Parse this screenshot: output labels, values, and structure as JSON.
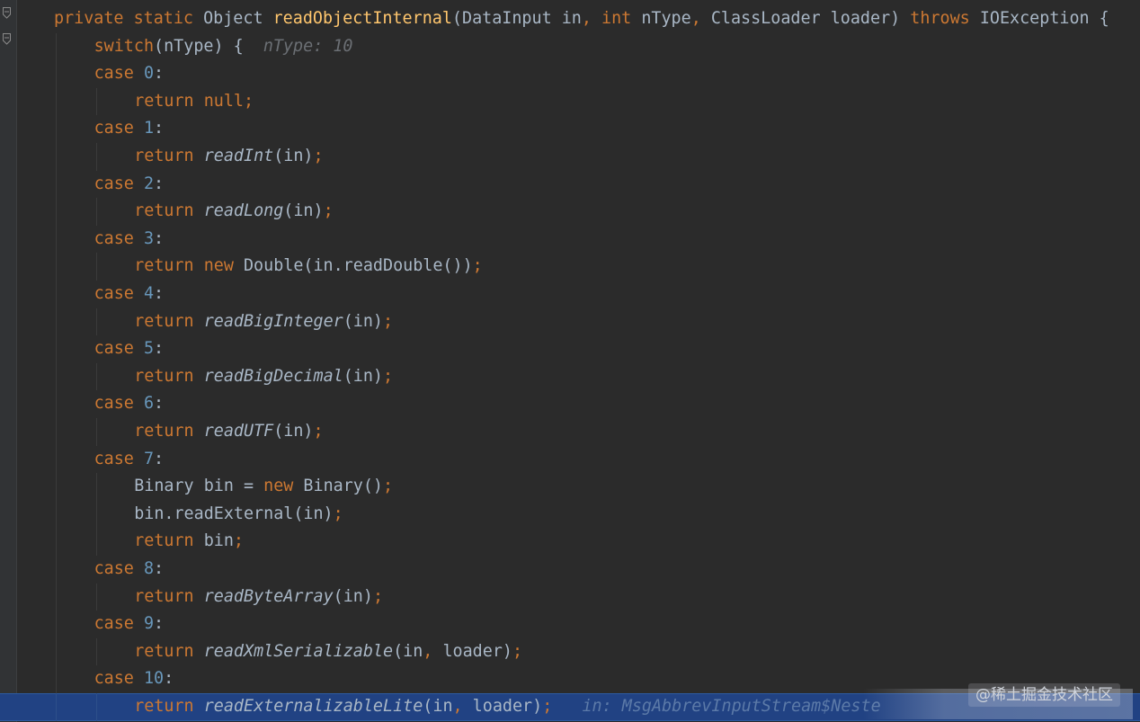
{
  "editor": {
    "hint_ntype": "nType: 10",
    "debug_inline": "in: MsgAbbrevInputStream$Neste",
    "watermark": "@稀土掘金技术社区",
    "lines": [
      {
        "indent": 0,
        "tokens": [
          {
            "t": "private static ",
            "c": "kw"
          },
          {
            "t": "Object ",
            "c": "plain"
          },
          {
            "t": "readObjectInternal",
            "c": "fn"
          },
          {
            "t": "(DataInput in",
            "c": "plain"
          },
          {
            "t": ", ",
            "c": "punct"
          },
          {
            "t": "int ",
            "c": "kw"
          },
          {
            "t": "nType",
            "c": "plain"
          },
          {
            "t": ", ",
            "c": "punct"
          },
          {
            "t": "ClassLoader loader) ",
            "c": "plain"
          },
          {
            "t": "throws ",
            "c": "kw"
          },
          {
            "t": "IOException {",
            "c": "plain"
          }
        ]
      },
      {
        "indent": 1,
        "tokens": [
          {
            "t": "switch",
            "c": "kw"
          },
          {
            "t": "(nType) {",
            "c": "plain"
          }
        ],
        "hint": true
      },
      {
        "indent": 1,
        "tokens": [
          {
            "t": "case ",
            "c": "kw"
          },
          {
            "t": "0",
            "c": "num"
          },
          {
            "t": ":",
            "c": "plain"
          }
        ]
      },
      {
        "indent": 2,
        "tokens": [
          {
            "t": "return null",
            "c": "kw"
          },
          {
            "t": ";",
            "c": "punct"
          }
        ]
      },
      {
        "indent": 1,
        "tokens": [
          {
            "t": "case ",
            "c": "kw"
          },
          {
            "t": "1",
            "c": "num"
          },
          {
            "t": ":",
            "c": "plain"
          }
        ]
      },
      {
        "indent": 2,
        "tokens": [
          {
            "t": "return ",
            "c": "kw"
          },
          {
            "t": "readInt",
            "c": "call"
          },
          {
            "t": "(in)",
            "c": "plain"
          },
          {
            "t": ";",
            "c": "punct"
          }
        ]
      },
      {
        "indent": 1,
        "tokens": [
          {
            "t": "case ",
            "c": "kw"
          },
          {
            "t": "2",
            "c": "num"
          },
          {
            "t": ":",
            "c": "plain"
          }
        ]
      },
      {
        "indent": 2,
        "tokens": [
          {
            "t": "return ",
            "c": "kw"
          },
          {
            "t": "readLong",
            "c": "call"
          },
          {
            "t": "(in)",
            "c": "plain"
          },
          {
            "t": ";",
            "c": "punct"
          }
        ]
      },
      {
        "indent": 1,
        "tokens": [
          {
            "t": "case ",
            "c": "kw"
          },
          {
            "t": "3",
            "c": "num"
          },
          {
            "t": ":",
            "c": "plain"
          }
        ]
      },
      {
        "indent": 2,
        "tokens": [
          {
            "t": "return new ",
            "c": "kw"
          },
          {
            "t": "Double(in.readDouble())",
            "c": "plain"
          },
          {
            "t": ";",
            "c": "punct"
          }
        ]
      },
      {
        "indent": 1,
        "tokens": [
          {
            "t": "case ",
            "c": "kw"
          },
          {
            "t": "4",
            "c": "num"
          },
          {
            "t": ":",
            "c": "plain"
          }
        ]
      },
      {
        "indent": 2,
        "tokens": [
          {
            "t": "return ",
            "c": "kw"
          },
          {
            "t": "readBigInteger",
            "c": "call"
          },
          {
            "t": "(in)",
            "c": "plain"
          },
          {
            "t": ";",
            "c": "punct"
          }
        ]
      },
      {
        "indent": 1,
        "tokens": [
          {
            "t": "case ",
            "c": "kw"
          },
          {
            "t": "5",
            "c": "num"
          },
          {
            "t": ":",
            "c": "plain"
          }
        ]
      },
      {
        "indent": 2,
        "tokens": [
          {
            "t": "return ",
            "c": "kw"
          },
          {
            "t": "readBigDecimal",
            "c": "call"
          },
          {
            "t": "(in)",
            "c": "plain"
          },
          {
            "t": ";",
            "c": "punct"
          }
        ]
      },
      {
        "indent": 1,
        "tokens": [
          {
            "t": "case ",
            "c": "kw"
          },
          {
            "t": "6",
            "c": "num"
          },
          {
            "t": ":",
            "c": "plain"
          }
        ]
      },
      {
        "indent": 2,
        "tokens": [
          {
            "t": "return ",
            "c": "kw"
          },
          {
            "t": "readUTF",
            "c": "call"
          },
          {
            "t": "(in)",
            "c": "plain"
          },
          {
            "t": ";",
            "c": "punct"
          }
        ]
      },
      {
        "indent": 1,
        "tokens": [
          {
            "t": "case ",
            "c": "kw"
          },
          {
            "t": "7",
            "c": "num"
          },
          {
            "t": ":",
            "c": "plain"
          }
        ]
      },
      {
        "indent": 2,
        "tokens": [
          {
            "t": "Binary bin = ",
            "c": "plain"
          },
          {
            "t": "new ",
            "c": "kw"
          },
          {
            "t": "Binary()",
            "c": "plain"
          },
          {
            "t": ";",
            "c": "punct"
          }
        ]
      },
      {
        "indent": 2,
        "tokens": [
          {
            "t": "bin.readExternal(in)",
            "c": "plain"
          },
          {
            "t": ";",
            "c": "punct"
          }
        ]
      },
      {
        "indent": 2,
        "tokens": [
          {
            "t": "return ",
            "c": "kw"
          },
          {
            "t": "bin",
            "c": "plain"
          },
          {
            "t": ";",
            "c": "punct"
          }
        ]
      },
      {
        "indent": 1,
        "tokens": [
          {
            "t": "case ",
            "c": "kw"
          },
          {
            "t": "8",
            "c": "num"
          },
          {
            "t": ":",
            "c": "plain"
          }
        ]
      },
      {
        "indent": 2,
        "tokens": [
          {
            "t": "return ",
            "c": "kw"
          },
          {
            "t": "readByteArray",
            "c": "call"
          },
          {
            "t": "(in)",
            "c": "plain"
          },
          {
            "t": ";",
            "c": "punct"
          }
        ]
      },
      {
        "indent": 1,
        "tokens": [
          {
            "t": "case ",
            "c": "kw"
          },
          {
            "t": "9",
            "c": "num"
          },
          {
            "t": ":",
            "c": "plain"
          }
        ]
      },
      {
        "indent": 2,
        "tokens": [
          {
            "t": "return ",
            "c": "kw"
          },
          {
            "t": "readXmlSerializable",
            "c": "call"
          },
          {
            "t": "(in",
            "c": "plain"
          },
          {
            "t": ", ",
            "c": "punct"
          },
          {
            "t": "loader)",
            "c": "plain"
          },
          {
            "t": ";",
            "c": "punct"
          }
        ]
      },
      {
        "indent": 1,
        "tokens": [
          {
            "t": "case ",
            "c": "kw"
          },
          {
            "t": "10",
            "c": "num"
          },
          {
            "t": ":",
            "c": "plain"
          }
        ]
      },
      {
        "indent": 2,
        "tokens": [
          {
            "t": "return ",
            "c": "kw"
          },
          {
            "t": "readExternalizableLite",
            "c": "call"
          },
          {
            "t": "(in",
            "c": "plain"
          },
          {
            "t": ", ",
            "c": "punct"
          },
          {
            "t": "loader)",
            "c": "plain"
          },
          {
            "t": ";",
            "c": "punct"
          }
        ],
        "current": true,
        "debug": true
      }
    ]
  },
  "colors": {
    "background": "#2b2b2b",
    "keyword": "#cc7832",
    "method_declaration": "#ffc66d",
    "number": "#6897bb",
    "plain": "#a9b7c6",
    "current_line": "#214283"
  }
}
